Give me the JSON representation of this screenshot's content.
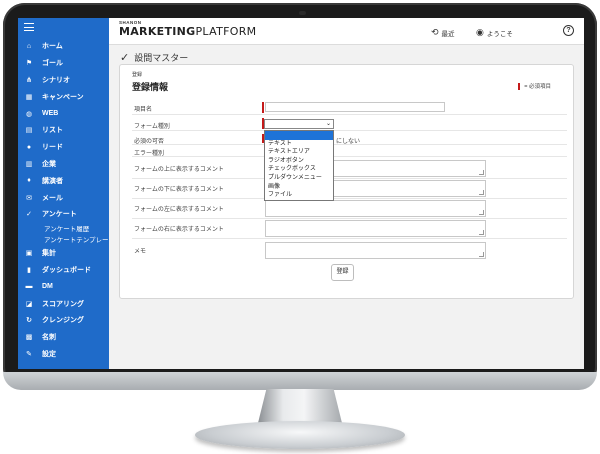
{
  "header": {
    "brand_top": "SHANON",
    "brand_main": "MARKETING",
    "brand_sub": "PLATFORM",
    "recent_label": "最近",
    "welcome_label": "ようこそ",
    "help_glyph": "?"
  },
  "sidebar": {
    "items": [
      {
        "label": "ホーム",
        "icon": "home-icon",
        "glyph": "⌂"
      },
      {
        "label": "ゴール",
        "icon": "flag-icon",
        "glyph": "⚑"
      },
      {
        "label": "シナリオ",
        "icon": "scenario-icon",
        "glyph": "⋔"
      },
      {
        "label": "キャンペーン",
        "icon": "calendar-icon",
        "glyph": "▦"
      },
      {
        "label": "WEB",
        "icon": "globe-icon",
        "glyph": "◍"
      },
      {
        "label": "リスト",
        "icon": "book-icon",
        "glyph": "▤"
      },
      {
        "label": "リード",
        "icon": "user-icon",
        "glyph": "●"
      },
      {
        "label": "企業",
        "icon": "company-icon",
        "glyph": "▥"
      },
      {
        "label": "講演者",
        "icon": "mic-icon",
        "glyph": "♦"
      },
      {
        "label": "メール",
        "icon": "mail-icon",
        "glyph": "✉"
      },
      {
        "label": "アンケート",
        "icon": "check-icon",
        "glyph": "✓"
      }
    ],
    "sub_items": [
      "アンケート履歴",
      "アンケートテンプレート"
    ],
    "items_after": [
      {
        "label": "集計",
        "icon": "tally-icon",
        "glyph": "▣"
      },
      {
        "label": "ダッシュボード",
        "icon": "bar-chart-icon",
        "glyph": "▮"
      },
      {
        "label": "DM",
        "icon": "dm-icon",
        "glyph": "▬"
      },
      {
        "label": "スコアリング",
        "icon": "scoring-icon",
        "glyph": "◪"
      },
      {
        "label": "クレンジング",
        "icon": "refresh-icon",
        "glyph": "↻"
      },
      {
        "label": "名刺",
        "icon": "card-icon",
        "glyph": "▩"
      },
      {
        "label": "設定",
        "icon": "wrench-icon",
        "glyph": "✎"
      }
    ]
  },
  "main": {
    "page_title": "設問マスター",
    "card_small": "登録",
    "card_title": "登録情報",
    "legend": "= 必須項目",
    "rows": {
      "item_name": "項目名",
      "form_type": "フォーム種別",
      "required": "必須の可否",
      "error_type": "エラー種別",
      "comment_above": "フォームの上に表示するコメント",
      "comment_below": "フォームの下に表示するコメント",
      "comment_left": "フォームの左に表示するコメント",
      "comment_right": "フォームの右に表示するコメント",
      "memo": "メモ"
    },
    "required_behind_text": "にしない",
    "dropdown_options": [
      "",
      "テキスト",
      "テキストエリア",
      "ラジオボタン",
      "チェックボックス",
      "プルダウンメニュー",
      "画像",
      "ファイル"
    ],
    "submit_label": "登録"
  },
  "colors": {
    "sidebar": "#1f6bc9",
    "required_mark": "#c41a1a",
    "selected_option": "#1e73d8"
  }
}
